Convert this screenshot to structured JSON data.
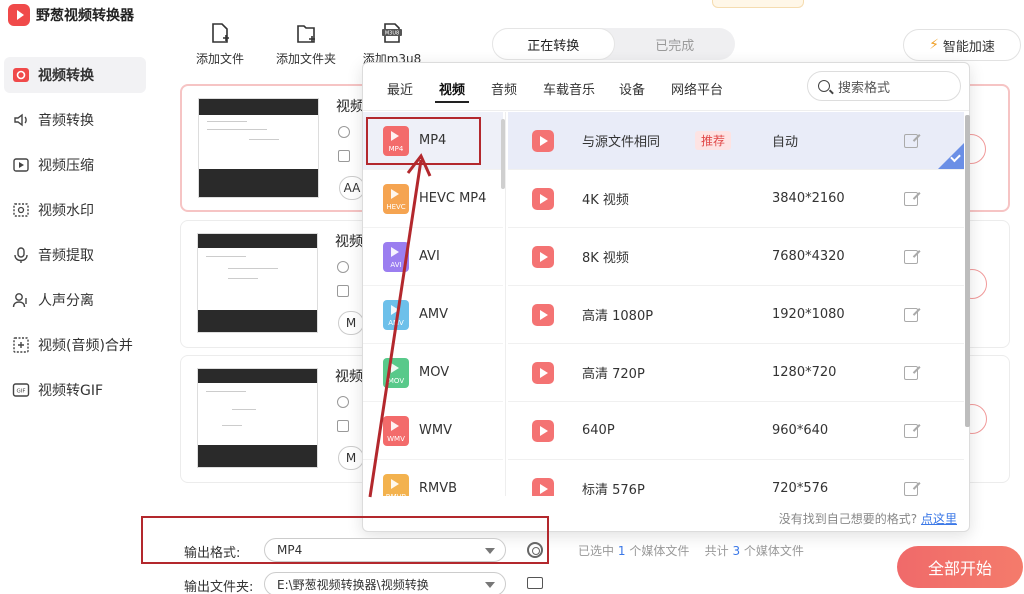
{
  "app": {
    "title": "野葱视频转换器"
  },
  "sidebar": {
    "items": [
      {
        "label": "视频转换",
        "icon": "video-convert-icon",
        "active": true
      },
      {
        "label": "音频转换",
        "icon": "audio-convert-icon"
      },
      {
        "label": "视频压缩",
        "icon": "video-compress-icon"
      },
      {
        "label": "视频水印",
        "icon": "watermark-icon"
      },
      {
        "label": "音频提取",
        "icon": "audio-extract-icon"
      },
      {
        "label": "人声分离",
        "icon": "voice-separate-icon"
      },
      {
        "label": "视频(音频)合并",
        "icon": "merge-icon"
      },
      {
        "label": "视频转GIF",
        "icon": "gif-icon"
      }
    ]
  },
  "toolbar": {
    "add_file": "添加文件",
    "add_folder": "添加文件夹",
    "add_m3u8": "添加m3u8",
    "m3u8_badge": "M3U8",
    "tab_converting": "正在转换",
    "tab_done": "已完成",
    "speed_up": "智能加速"
  },
  "cards": [
    {
      "name": "视频",
      "pill": "AA"
    },
    {
      "name": "视频",
      "pill": "M"
    },
    {
      "name": "视频",
      "pill": "M"
    }
  ],
  "popup": {
    "tabs": [
      "最近",
      "视频",
      "音频",
      "车载音乐",
      "设备",
      "网络平台"
    ],
    "active_tab": "视频",
    "search_placeholder": "搜索格式",
    "formats": [
      {
        "label": "MP4",
        "tag": "MP4",
        "color": "#f36b6b"
      },
      {
        "label": "HEVC MP4",
        "tag": "HEVC",
        "color": "#f5a451"
      },
      {
        "label": "AVI",
        "tag": "AVI",
        "color": "#9b7ef0"
      },
      {
        "label": "AMV",
        "tag": "AMV",
        "color": "#6dc0ea"
      },
      {
        "label": "MOV",
        "tag": "MOV",
        "color": "#58c98a"
      },
      {
        "label": "WMV",
        "tag": "WMV",
        "color": "#f36b6b"
      },
      {
        "label": "RMVB",
        "tag": "RMVB",
        "color": "#f3b24e"
      }
    ],
    "presets": [
      {
        "name": "与源文件相同",
        "badge": "推荐",
        "res": "自动"
      },
      {
        "name": "4K 视频",
        "res": "3840*2160"
      },
      {
        "name": "8K 视频",
        "res": "7680*4320"
      },
      {
        "name": "高清 1080P",
        "res": "1920*1080"
      },
      {
        "name": "高清 720P",
        "res": "1280*720"
      },
      {
        "name": "640P",
        "res": "960*640"
      },
      {
        "name": "标清 576P",
        "res": "720*576"
      }
    ],
    "footer_text": "没有找到自己想要的格式?",
    "footer_link": "点这里"
  },
  "bottom": {
    "output_format_label": "输出格式:",
    "output_format_value": "MP4",
    "output_folder_label": "输出文件夹:",
    "output_folder_value": "E:\\野葱视频转换器\\视频转换",
    "status_selected_prefix": "已选中",
    "status_selected_count": "1",
    "status_selected_suffix": "个媒体文件",
    "status_total_prefix": "共计",
    "status_total_count": "3",
    "status_total_suffix": "个媒体文件",
    "start_all": "全部开始"
  },
  "colors": {
    "accent": "#f06a6a",
    "annotation": "#b3282d",
    "link": "#3b78e7"
  }
}
